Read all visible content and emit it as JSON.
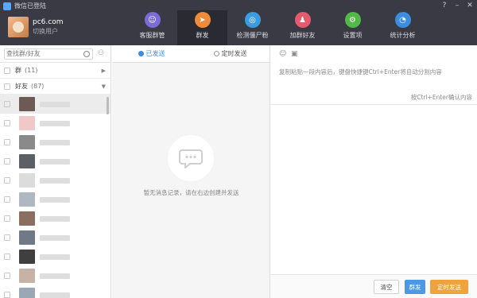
{
  "window": {
    "title": "微信已登陆"
  },
  "user": {
    "name": "pc6.com",
    "status": "切换用户"
  },
  "nav": [
    {
      "label": "客服群管",
      "icon": "customer-service-icon",
      "color": "#7a6bd9"
    },
    {
      "label": "群发",
      "icon": "send-plane-icon",
      "color": "#f08a3b",
      "active": true
    },
    {
      "label": "检测僵尸粉",
      "icon": "scan-search-icon",
      "color": "#3b9de0"
    },
    {
      "label": "加群好友",
      "icon": "add-friend-icon",
      "color": "#e55a6c"
    },
    {
      "label": "设置项",
      "icon": "gear-icon",
      "color": "#52b849"
    },
    {
      "label": "统计分析",
      "icon": "pie-chart-icon",
      "color": "#3b8de0"
    }
  ],
  "sidebar": {
    "search_placeholder": "查找群/好友",
    "groups": [
      {
        "label": "群",
        "count": "(11)"
      },
      {
        "label": "好友",
        "count": "(87)"
      }
    ],
    "contact_avatar_colors": [
      "#6b5a55",
      "#f0c8c8",
      "#8a8a8a",
      "#5b5f66",
      "#dcdcdc",
      "#aeb8c2",
      "#8c6e60",
      "#6f7a86",
      "#3f3f3f",
      "#c7b2a6",
      "#9aa8b4"
    ]
  },
  "middle": {
    "tabs": [
      {
        "label": "已发送",
        "active": true
      },
      {
        "label": "定时发送",
        "active": false
      }
    ],
    "empty_text": "暂无消息记录，请在右边创建并发送"
  },
  "editor": {
    "placeholder": "复制粘贴一段内容后，键盘快捷键Ctrl+Enter将自动分割内容",
    "hint": "按Ctrl+Enter确认内容"
  },
  "buttons": {
    "clear": "清空",
    "send": "群发",
    "timed": "定时发送"
  }
}
